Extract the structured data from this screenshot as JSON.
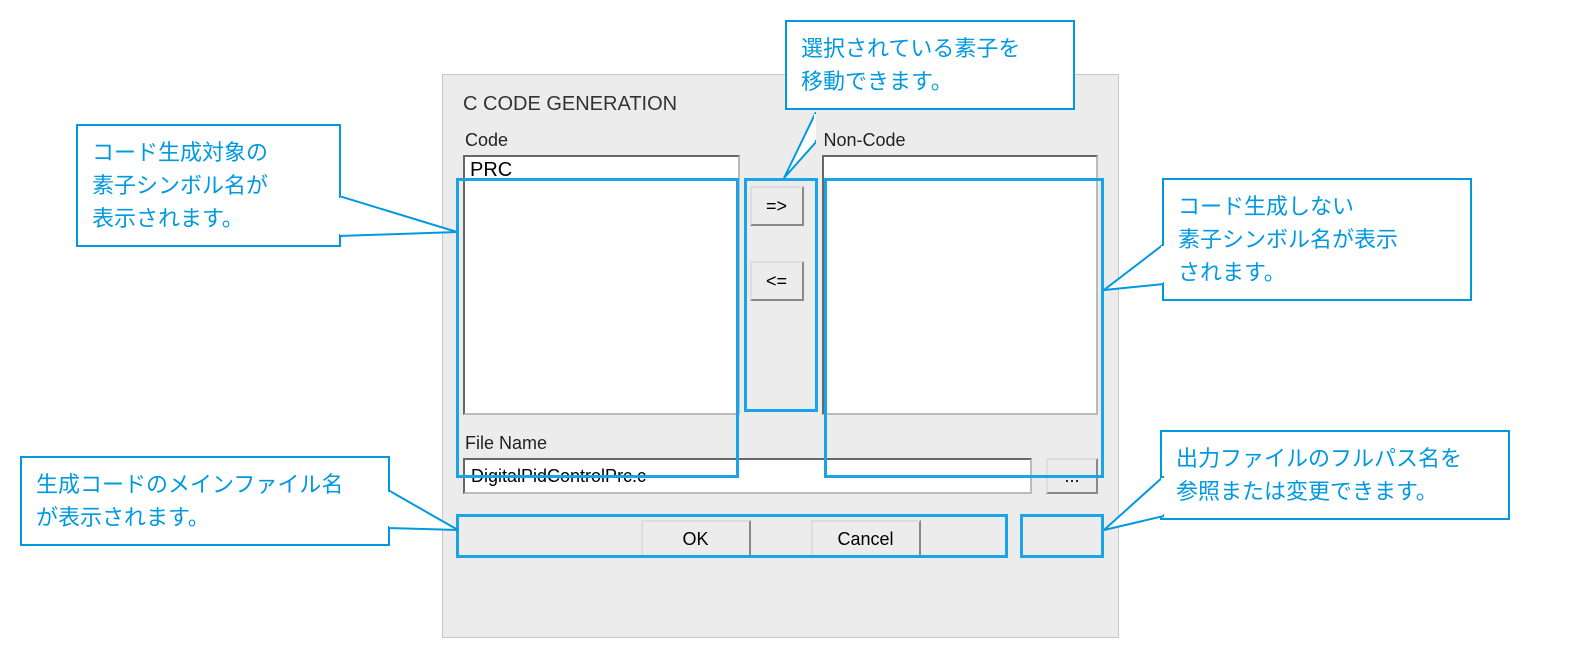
{
  "dialog": {
    "title": "C CODE GENERATION",
    "code_label": "Code",
    "noncode_label": "Non-Code",
    "code_items": [
      "PRC"
    ],
    "noncode_items": [],
    "move_right_label": "=>",
    "move_left_label": "<=",
    "file_label": "File Name",
    "file_value": "DigitalPidControlPrc.c",
    "browse_label": "...",
    "ok_label": "OK",
    "cancel_label": "Cancel"
  },
  "callouts": {
    "top": "選択されている素子を\n移動できます。",
    "left1": "コード生成対象の\n素子シンボル名が\n表示されます。",
    "right1": "コード生成しない\n素子シンボル名が表示\nされます。",
    "left2": "生成コードのメインファイル名\nが表示されます。",
    "right2": "出力ファイルのフルパス名を\n参照または変更できます。"
  }
}
